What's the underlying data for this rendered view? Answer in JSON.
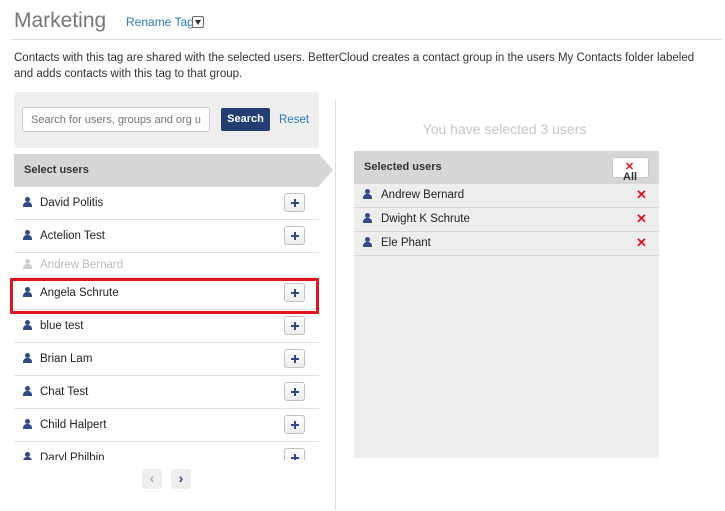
{
  "header": {
    "title": "Marketing",
    "rename_label": "Rename Tag"
  },
  "description": "Contacts with this tag are shared with the selected users. BetterCloud creates a contact group in the users My Contacts folder labeled and adds contacts with this tag to that group.",
  "search": {
    "placeholder": "Search for users, groups and org u",
    "button_label": "Search",
    "reset_label": "Reset"
  },
  "select_users": {
    "header": "Select users",
    "users": [
      {
        "name": "David Politis",
        "state": "available"
      },
      {
        "name": "Actelion Test",
        "state": "available"
      },
      {
        "name": "Andrew Bernard",
        "state": "selected"
      },
      {
        "name": "Angela Schrute",
        "state": "available",
        "highlighted": true
      },
      {
        "name": "blue test",
        "state": "available"
      },
      {
        "name": "Brian Lam",
        "state": "available"
      },
      {
        "name": "Chat Test",
        "state": "available"
      },
      {
        "name": "Child Halpert",
        "state": "available"
      },
      {
        "name": "Daryl Philbin",
        "state": "available"
      }
    ]
  },
  "pager": {
    "prev_icon": "chevron-left-icon",
    "next_icon": "chevron-right-icon"
  },
  "selected_users": {
    "summary": "You have selected 3 users",
    "header": "Selected users",
    "clear_all_label": "All",
    "users": [
      "Andrew Bernard",
      "Dwight K Schrute",
      "Ele Phant"
    ]
  },
  "colors": {
    "primary_button": "#243d72",
    "link": "#2a7ab8",
    "highlight_border": "#e0141e",
    "remove": "#e0141e",
    "user_icon": "#2f4a87"
  }
}
